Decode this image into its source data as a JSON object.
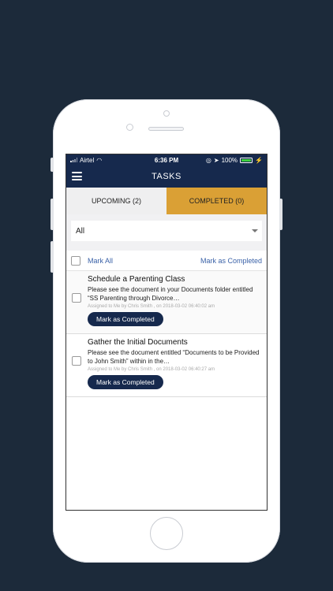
{
  "status_bar": {
    "carrier": "Airtel",
    "time": "6:36 PM",
    "battery": "100%",
    "battery_level": 1.0
  },
  "nav": {
    "title": "TASKS",
    "menu_icon": "hamburger-menu-icon"
  },
  "tabs": [
    {
      "label": "UPCOMING (2)"
    },
    {
      "label": "COMPLETED (0)"
    }
  ],
  "filter": {
    "selected": "All"
  },
  "bulk_actions": {
    "mark_all": "Mark All",
    "mark_as_completed": "Mark as Completed"
  },
  "tasks": [
    {
      "title": "Schedule a Parenting Class",
      "description": "Please see the document in your Documents folder entitled “SS Parenting through Divorce…",
      "meta": "Assigned to Me by Chris Smith , on 2018-03-02 06:40:02 am",
      "button": "Mark as Completed"
    },
    {
      "title": "Gather the Initial Documents",
      "description": "Please see the document entitled “Documents to be Provided to John Smith” within in the…",
      "meta": "Assigned to Me by Chris Smith , on 2018-03-02 06:40:27 am",
      "button": "Mark as Completed"
    }
  ],
  "colors": {
    "background": "#1c2a3a",
    "header": "#16294d",
    "completed_tab": "#daa035",
    "link": "#3b62a8"
  }
}
